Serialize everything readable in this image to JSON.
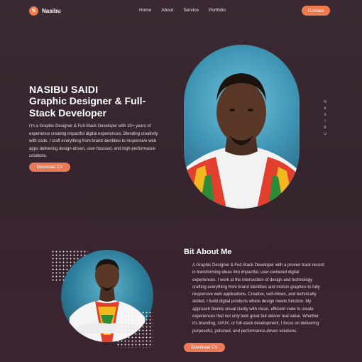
{
  "brand": {
    "logo_letter": "N",
    "name": "Nasibu",
    "accent_color": "#f07a4e"
  },
  "nav": {
    "items": [
      "Home",
      "About",
      "Service",
      "Portfolio"
    ],
    "contact_label": "Contact"
  },
  "hero": {
    "name": "NASIBU SAIDI",
    "role": "Graphic Designer & Full-Stack Developer",
    "description": "I'm a Graphic Designer & Full-Stack Developer with 10+ years of experience creating impactful digital experiences. Blending creativity with code, I craft everything from brand identities to responsive web apps delivering design-driven, user-focused, and high-performance solutions.",
    "cta_label": "Download CV",
    "vertical_text": "NASIBU"
  },
  "about": {
    "title": "Bit About Me",
    "text": "A Graphic Designer & Full-Stack Developer with a proven track record in transforming ideas into impactful, user-centered digital experiences. I work at the intersection of design and technology crafting everything from brand identities and motion graphics to fully responsive web applications. Creative, self-driven, and technically skilled, I build digital products where design meets function. My approach blends visual clarity with clean, efficient code to create experiences that not only look great but deliver real value. Whether it's branding, UI/UX, or full-stack development, I focus on delivering purposeful, polished, and performance-driven solutions.",
    "cta_label": "Download CV"
  }
}
